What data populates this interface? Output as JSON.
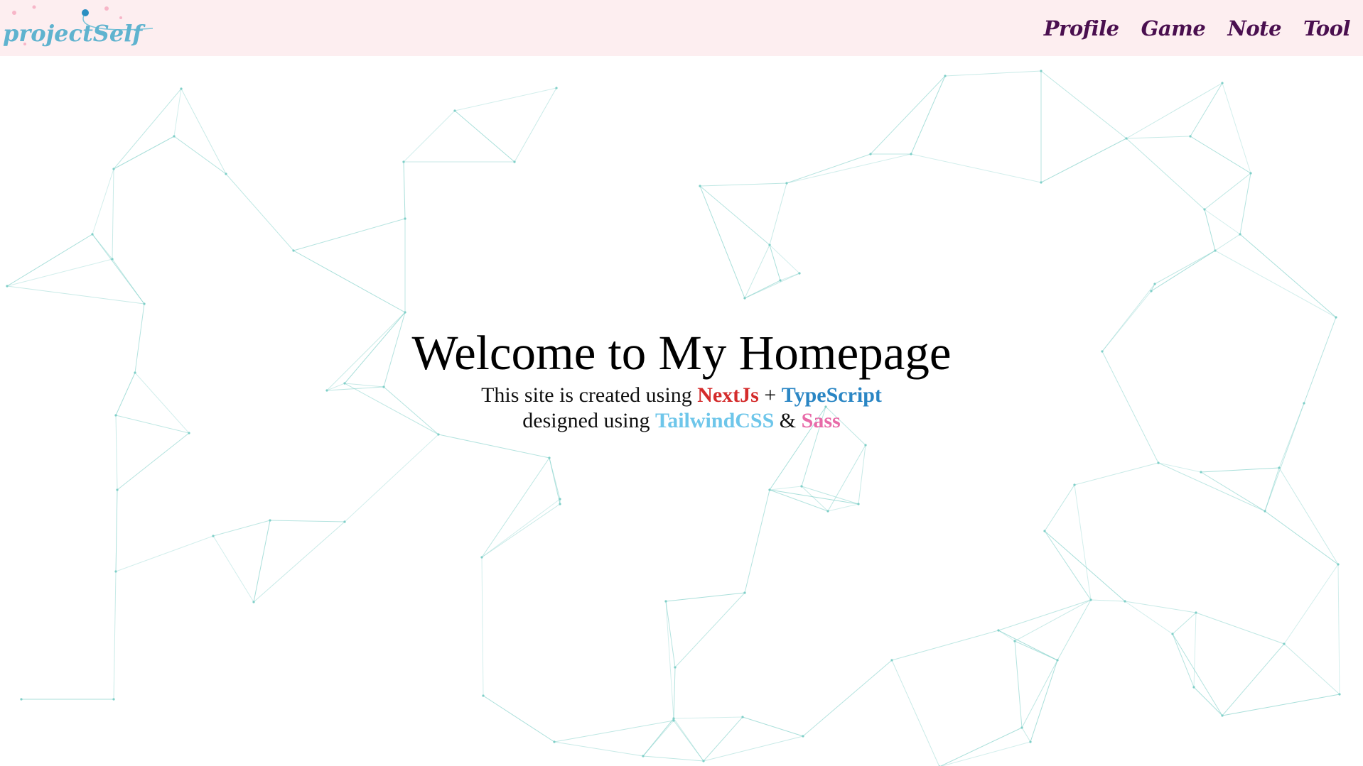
{
  "header": {
    "logo_text": "projectSelf",
    "nav": [
      {
        "label": "Profile"
      },
      {
        "label": "Game"
      },
      {
        "label": "Note"
      },
      {
        "label": "Tool"
      }
    ]
  },
  "hero": {
    "title": "Welcome to My Homepage",
    "line1_prefix": "This site is created using",
    "tech1": "NextJs",
    "plus": "+",
    "tech2": "TypeScript",
    "line2_prefix": "designed using",
    "tech3": "TailwindCSS",
    "amp": "&",
    "tech4": "Sass"
  },
  "colors": {
    "header_bg": "#fdeef0",
    "nav_text": "#4a0f4f",
    "nextjs": "#d42b2b",
    "typescript": "#2a86c4",
    "tailwind": "#6ec6ea",
    "sass": "#e86aa8",
    "network_line": "#7fcfc8"
  }
}
